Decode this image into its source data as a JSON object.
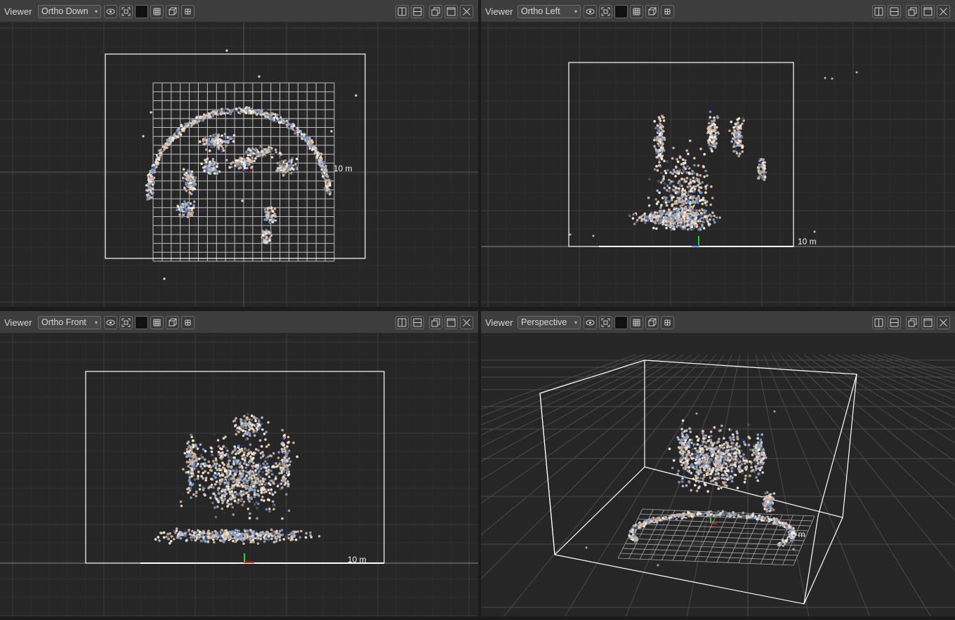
{
  "colors": {
    "toolbar_bg": "#3d3d3d",
    "viewport_bg": "#262626",
    "grid_major": "#3a3a3a",
    "axis_line": "#555555",
    "box": "#ffffff",
    "points_light": "#e8d8c4",
    "points_blue": "#5b8fe0",
    "points_dark": "#3a3a48"
  },
  "viewers": [
    {
      "title": "Viewer",
      "mode": "Ortho Down",
      "scale_label": "10 m"
    },
    {
      "title": "Viewer",
      "mode": "Ortho Left",
      "scale_label": "10 m"
    },
    {
      "title": "Viewer",
      "mode": "Ortho Front",
      "scale_label": "10 m"
    },
    {
      "title": "Viewer",
      "mode": "Perspective",
      "scale_label": "10 m"
    }
  ],
  "toolbar_icons": [
    "eye-icon",
    "fit-view-icon",
    "background-color-swatch",
    "grid-toggle-icon",
    "box-toggle-icon",
    "small-grid-icon"
  ],
  "window_icons": [
    "split-vertical-icon",
    "split-horizontal-icon",
    "restore-icon",
    "maximize-icon",
    "close-icon"
  ]
}
